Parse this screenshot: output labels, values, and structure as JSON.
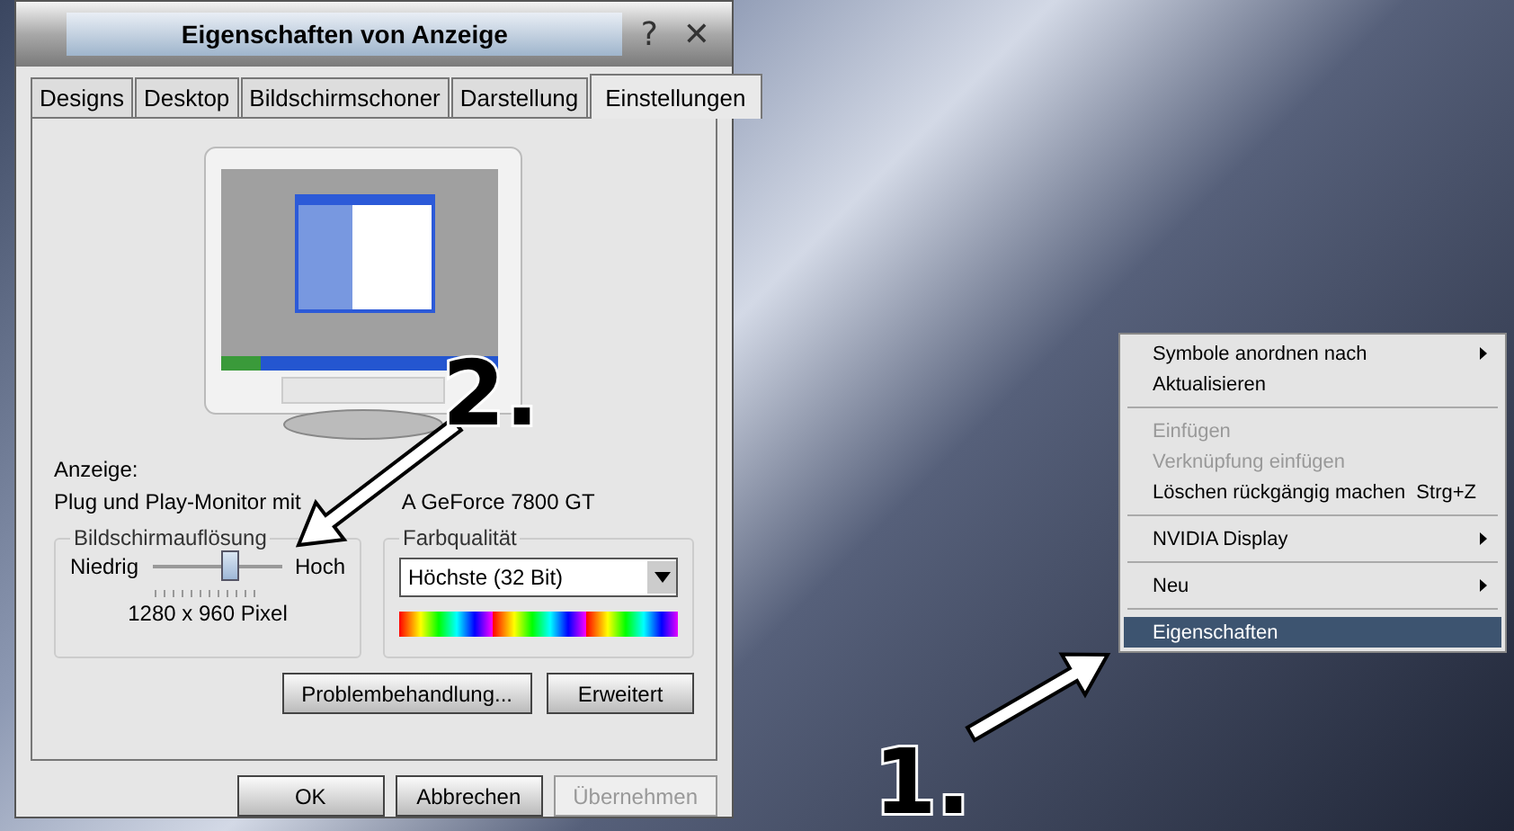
{
  "dialog": {
    "title": "Eigenschaften von Anzeige",
    "help_button": "?",
    "close_button": "✕",
    "tabs": [
      {
        "label": "Designs",
        "selected": false
      },
      {
        "label": "Desktop",
        "selected": false
      },
      {
        "label": "Bildschirmschoner",
        "selected": false
      },
      {
        "label": "Darstellung",
        "selected": false
      },
      {
        "label": "Einstellungen",
        "selected": true
      }
    ],
    "display_label": "Anzeige:",
    "display_name_parts": [
      "Plug und Play-Monitor mit",
      "A GeForce 7800 GT"
    ],
    "resolution": {
      "legend": "Bildschirmauflösung",
      "low": "Niedrig",
      "high": "Hoch",
      "level": 0.6,
      "reading": "1280 x 960 Pixel"
    },
    "color_quality": {
      "legend": "Farbqualität",
      "value": "Höchste (32 Bit)"
    },
    "panel_buttons": [
      {
        "label": "Problembehandlung...",
        "disabled": false
      },
      {
        "label": "Erweitert",
        "disabled": false
      }
    ],
    "footer_buttons": [
      {
        "label": "OK",
        "disabled": false
      },
      {
        "label": "Abbrechen",
        "disabled": false
      },
      {
        "label": "Übernehmen",
        "disabled": true
      }
    ]
  },
  "context_menu": {
    "items": [
      {
        "kind": "item",
        "label": "Symbole anordnen nach",
        "disabled": false,
        "submenu": true,
        "selected": false
      },
      {
        "kind": "item",
        "label": "Aktualisieren",
        "disabled": false,
        "submenu": false,
        "selected": false
      },
      {
        "kind": "separator"
      },
      {
        "kind": "item",
        "label": "Einfügen",
        "disabled": true,
        "submenu": false,
        "selected": false
      },
      {
        "kind": "item",
        "label": "Verknüpfung einfügen",
        "disabled": true,
        "submenu": false,
        "selected": false
      },
      {
        "kind": "item",
        "label": "Löschen rückgängig machen",
        "shortcut": "Strg+Z",
        "disabled": false,
        "submenu": false,
        "selected": false
      },
      {
        "kind": "separator"
      },
      {
        "kind": "item",
        "label": "NVIDIA Display",
        "disabled": false,
        "submenu": true,
        "selected": false
      },
      {
        "kind": "separator"
      },
      {
        "kind": "item",
        "label": "Neu",
        "disabled": false,
        "submenu": true,
        "selected": false
      },
      {
        "kind": "separator"
      },
      {
        "kind": "item",
        "label": "Eigenschaften",
        "disabled": false,
        "submenu": false,
        "selected": true
      }
    ]
  },
  "annotations": [
    {
      "label": "1."
    },
    {
      "label": "2."
    }
  ]
}
